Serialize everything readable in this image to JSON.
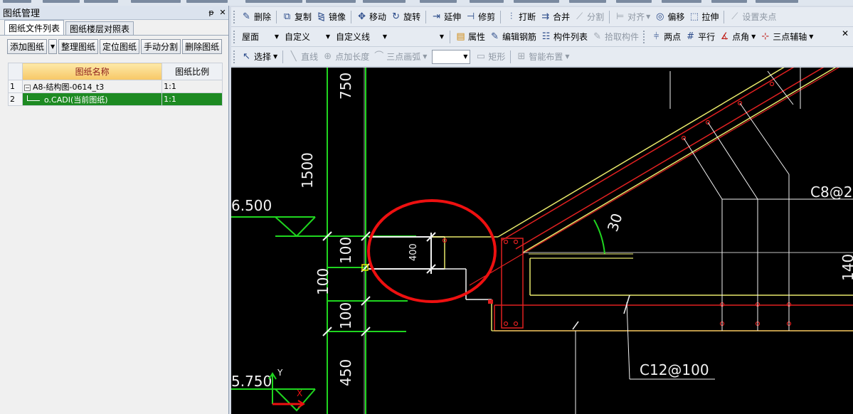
{
  "panel": {
    "title": "图纸管理",
    "pin": "ᵽ",
    "close": "✕",
    "tabs": [
      "图纸文件列表",
      "图纸楼层对照表"
    ],
    "buttons": [
      "添加图纸",
      "整理图纸",
      "定位图纸",
      "手动分割",
      "删除图纸"
    ],
    "table": {
      "col_name": "图纸名称",
      "col_scale": "图纸比例",
      "rows": [
        {
          "num": "1",
          "name": "A8-结构图-0614_t3",
          "scale": "1:1"
        },
        {
          "num": "2",
          "name": "o.CADI(当前图纸)",
          "scale": "1:1"
        }
      ]
    }
  },
  "toolbar1": {
    "items": [
      "删除",
      "复制",
      "镜像",
      "移动",
      "旋转",
      "延伸",
      "修剪",
      "打断",
      "合并",
      "分割",
      "对齐",
      "偏移",
      "拉伸",
      "设置夹点"
    ]
  },
  "toolbar2": {
    "floor": "屋面",
    "custom": "自定义",
    "custom_line": "自定义线",
    "items": [
      "属性",
      "编辑钢筋",
      "构件列表",
      "拾取构件",
      "两点",
      "平行",
      "点角",
      "三点辅轴"
    ],
    "close": "✕"
  },
  "toolbar3": {
    "items": [
      "选择",
      "直线",
      "点加长度",
      "三点画弧",
      "矩形",
      "智能布置"
    ]
  },
  "cad": {
    "dims": [
      "750",
      "1500",
      "100",
      "100",
      "100",
      "450",
      "400"
    ],
    "elevations": [
      "6.500",
      "5.750"
    ],
    "angle": "30",
    "rebar1": "C8@2",
    "rebar2": "C12@100",
    "partial": "140",
    "axis_y": "Y",
    "axis_x": "X"
  }
}
